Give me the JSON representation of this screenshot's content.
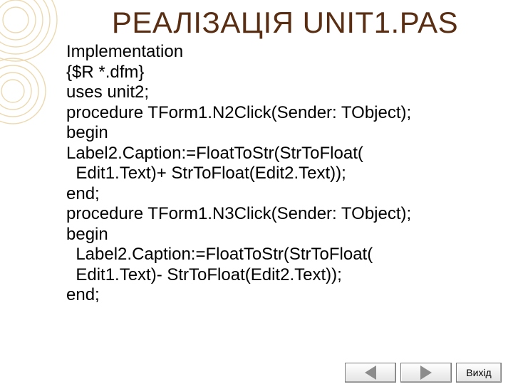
{
  "slide": {
    "title": "РЕАЛІЗАЦІЯ UNIT1.PAS"
  },
  "code_lines": [
    "Implementation",
    "{$R *.dfm}",
    "uses unit2;",
    "procedure TForm1.N2Click(Sender: TObject);",
    "begin",
    "Label2.Caption:=FloatToStr(StrToFloat(",
    "  Edit1.Text)+ StrToFloat(Edit2.Text));",
    "end;",
    "procedure TForm1.N3Click(Sender: TObject);",
    "begin",
    "  Label2.Caption:=FloatToStr(StrToFloat(",
    "  Edit1.Text)- StrToFloat(Edit2.Text));",
    "end;"
  ],
  "navigation": {
    "back_icon": "triangle-left-icon",
    "forward_icon": "triangle-right-icon",
    "exit_label": "Вихід"
  },
  "colors": {
    "title": "#5a2e12",
    "decoration": "#e6cfa0",
    "nav_arrow": "#8c8c8c"
  }
}
